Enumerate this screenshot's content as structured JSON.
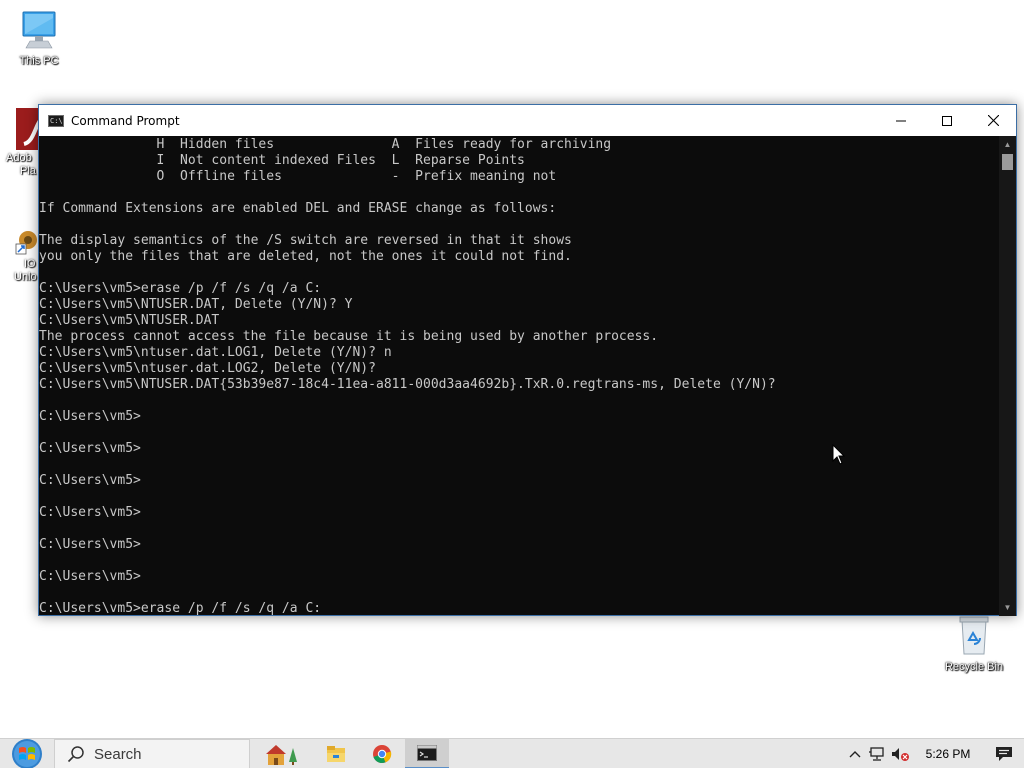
{
  "desktop": {
    "icons": [
      {
        "label": "This PC"
      },
      {
        "label": "Recycle Bin"
      }
    ],
    "partial_icons": [
      {
        "label": "Adobe Pla",
        "line1": "Adob",
        "line2": "Pla"
      },
      {
        "label": "IO Unlo",
        "line1": "IO",
        "line2": "Unlo"
      }
    ]
  },
  "window": {
    "title": "Command Prompt",
    "console_lines": [
      "               H  Hidden files               A  Files ready for archiving",
      "               I  Not content indexed Files  L  Reparse Points",
      "               O  Offline files              -  Prefix meaning not",
      "",
      "If Command Extensions are enabled DEL and ERASE change as follows:",
      "",
      "The display semantics of the /S switch are reversed in that it shows",
      "you only the files that are deleted, not the ones it could not find.",
      "",
      "C:\\Users\\vm5>erase /p /f /s /q /a C:",
      "C:\\Users\\vm5\\NTUSER.DAT, Delete (Y/N)? Y",
      "C:\\Users\\vm5\\NTUSER.DAT",
      "The process cannot access the file because it is being used by another process.",
      "C:\\Users\\vm5\\ntuser.dat.LOG1, Delete (Y/N)? n",
      "C:\\Users\\vm5\\ntuser.dat.LOG2, Delete (Y/N)?",
      "C:\\Users\\vm5\\NTUSER.DAT{53b39e87-18c4-11ea-a811-000d3aa4692b}.TxR.0.regtrans-ms, Delete (Y/N)?",
      "",
      "C:\\Users\\vm5>",
      "",
      "C:\\Users\\vm5>",
      "",
      "C:\\Users\\vm5>",
      "",
      "C:\\Users\\vm5>",
      "",
      "C:\\Users\\vm5>",
      "",
      "C:\\Users\\vm5>",
      "",
      "C:\\Users\\vm5>erase /p /f /s /q /a C:"
    ]
  },
  "taskbar": {
    "search_placeholder": "Search",
    "apps": [
      "store-icon",
      "file-explorer-icon",
      "chrome-icon",
      "command-prompt-icon"
    ],
    "clock": "5:26 PM"
  },
  "colors": {
    "console_bg": "#0c0c0c",
    "console_text": "#c8c8c8",
    "taskbar_bg": "#e7e7e7",
    "active_task_accent": "#5a8fc8"
  }
}
